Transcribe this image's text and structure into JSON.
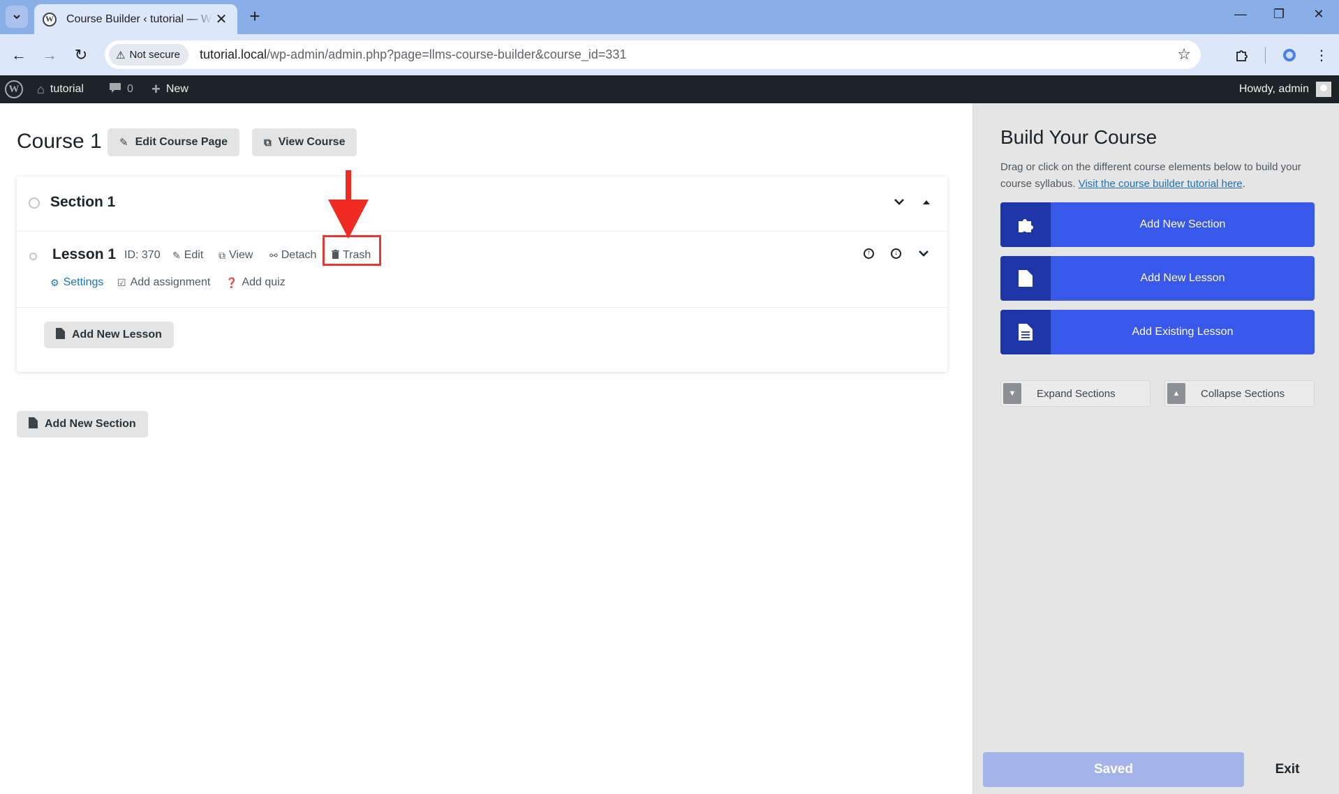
{
  "browser": {
    "tab_title": "Course Builder ‹ tutorial — WordPress",
    "security_label": "Not secure",
    "url_host": "tutorial.local",
    "url_path": "/wp-admin/admin.php?page=llms-course-builder&course_id=331"
  },
  "adminbar": {
    "site_name": "tutorial",
    "comments_count": "0",
    "new_label": "New",
    "howdy": "Howdy, admin"
  },
  "course": {
    "title": "Course 1",
    "edit_page_label": "Edit Course Page",
    "view_course_label": "View Course"
  },
  "section": {
    "title": "Section 1",
    "lesson": {
      "title": "Lesson 1",
      "id_label": "ID: 370",
      "edit_label": "Edit",
      "view_label": "View",
      "detach_label": "Detach",
      "trash_label": "Trash",
      "settings_label": "Settings",
      "assignment_label": "Add assignment",
      "quiz_label": "Add quiz"
    },
    "add_lesson_label": "Add New Lesson"
  },
  "add_section_label": "Add New Section",
  "sidebar": {
    "title": "Build Your Course",
    "description": "Drag or click on the different course elements below to build your course syllabus. ",
    "tutorial_link": "Visit the course builder tutorial here",
    "description_end": ".",
    "buttons": [
      {
        "label": "Add New Section",
        "icon": "puzzle-icon"
      },
      {
        "label": "Add New Lesson",
        "icon": "page-icon"
      },
      {
        "label": "Add Existing Lesson",
        "icon": "document-icon"
      }
    ],
    "expand_label": "Expand Sections",
    "collapse_label": "Collapse Sections",
    "saved_label": "Saved",
    "exit_label": "Exit"
  },
  "colors": {
    "accent_blue": "#3858e9",
    "annotation_red": "#ef2b24",
    "adminbar": "#1d2327"
  }
}
